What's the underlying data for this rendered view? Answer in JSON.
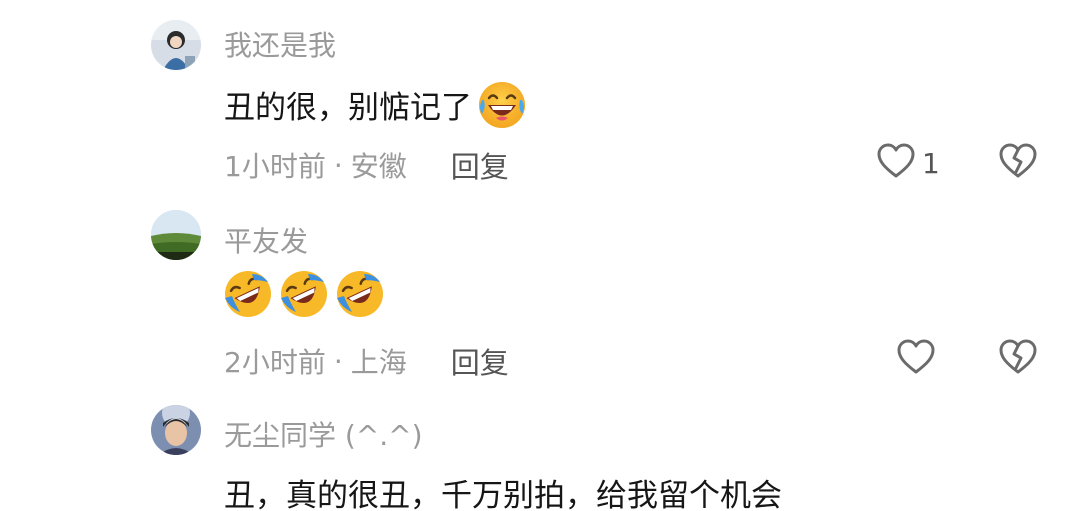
{
  "comments": [
    {
      "username": "我还是我",
      "text": "丑的很，别惦记了",
      "emojis": [
        "laughing-tears"
      ],
      "time": "1小时前",
      "separator": "·",
      "location": "安徽",
      "reply_label": "回复",
      "like_count": "1"
    },
    {
      "username": "平友发",
      "text": "",
      "emojis": [
        "rolling-laugh",
        "rolling-laugh",
        "rolling-laugh"
      ],
      "time": "2小时前",
      "separator": "·",
      "location": "上海",
      "reply_label": "回复",
      "like_count": ""
    },
    {
      "username": "无尘同学 (^.^)",
      "text": "丑，真的很丑，千万别拍，给我留个机会"
    }
  ],
  "colors": {
    "username": "#9a9a9a",
    "text": "#161616",
    "meta": "#9a9a9a",
    "icon": "#6b6b6b"
  }
}
